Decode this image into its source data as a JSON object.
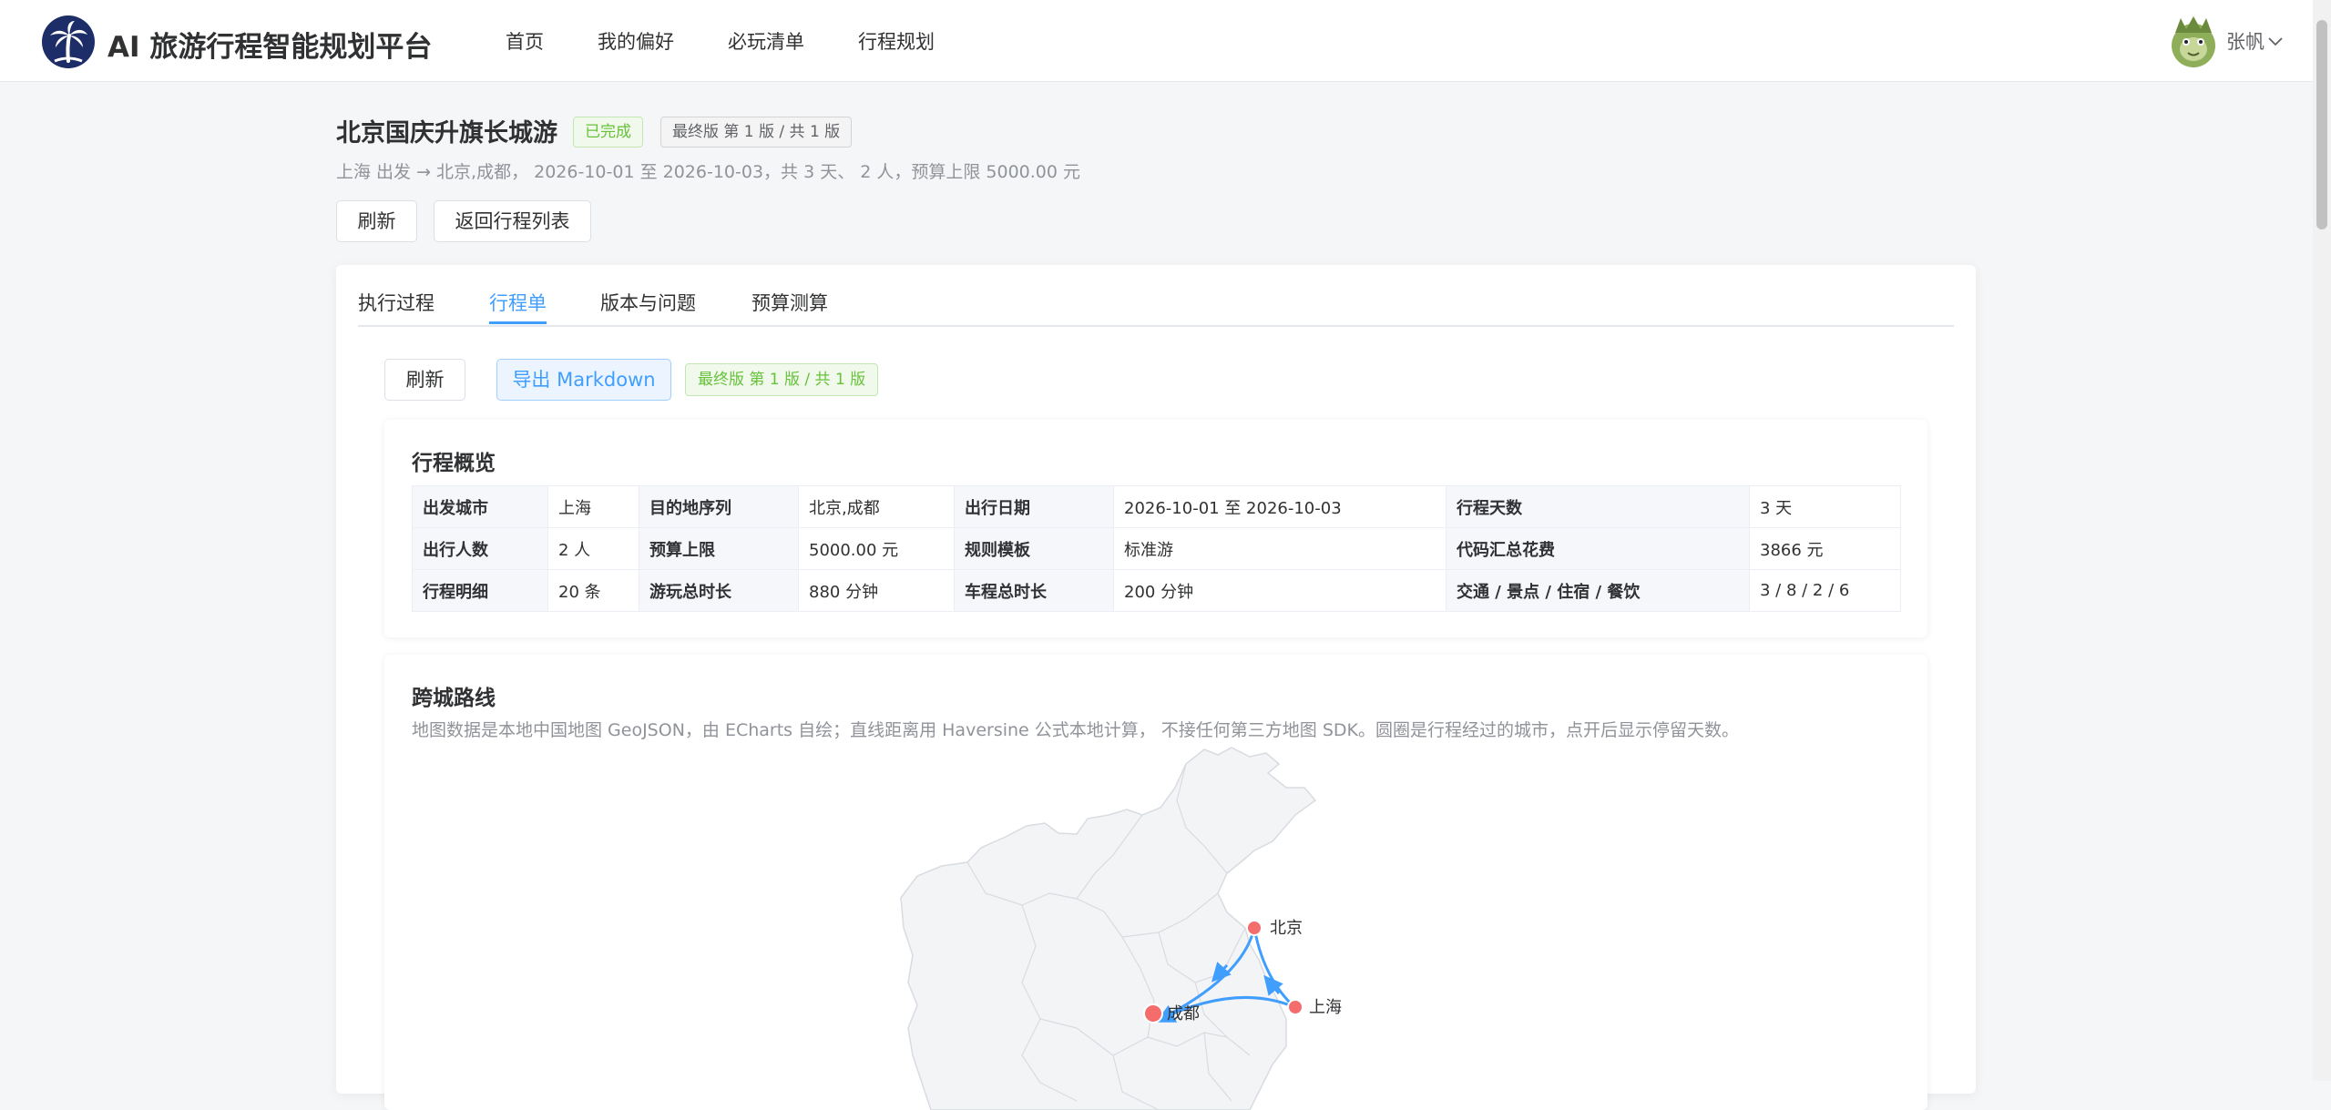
{
  "app": {
    "brand": "AI 旅游行程智能规划平台",
    "nav": [
      "首页",
      "我的偏好",
      "必玩清单",
      "行程规划"
    ],
    "user": {
      "name": "张帆"
    }
  },
  "trip": {
    "title": "北京国庆升旗长城游",
    "status": "已完成",
    "version_tag": "最终版 第 1 版 / 共 1 版",
    "summary": "上海 出发 → 北京,成都， 2026-10-01 至 2026-10-03，共 3 天、 2 人，预算上限 5000.00 元",
    "refresh_label": "刷新",
    "back_label": "返回行程列表"
  },
  "tabs": [
    {
      "label": "执行过程",
      "active": false
    },
    {
      "label": "行程单",
      "active": true
    },
    {
      "label": "版本与问题",
      "active": false
    },
    {
      "label": "预算测算",
      "active": false
    }
  ],
  "itinerary": {
    "refresh_label": "刷新",
    "export_label": "导出 Markdown",
    "version_tag": "最终版 第 1 版 / 共 1 版",
    "overview": {
      "title": "行程概览",
      "rows": [
        [
          {
            "label": "出发城市",
            "value": "上海"
          },
          {
            "label": "目的地序列",
            "value": "北京,成都"
          },
          {
            "label": "出行日期",
            "value": "2026-10-01 至 2026-10-03"
          },
          {
            "label": "行程天数",
            "value": "3 天"
          }
        ],
        [
          {
            "label": "出行人数",
            "value": "2 人"
          },
          {
            "label": "预算上限",
            "value": "5000.00 元"
          },
          {
            "label": "规则模板",
            "value": "标准游"
          },
          {
            "label": "代码汇总花费",
            "value": "3866 元"
          }
        ],
        [
          {
            "label": "行程明细",
            "value": "20 条"
          },
          {
            "label": "游玩总时长",
            "value": "880 分钟"
          },
          {
            "label": "车程总时长",
            "value": "200 分钟"
          },
          {
            "label": "交通 / 景点 / 住宿 / 餐饮",
            "value": "3 / 8 / 2 / 6"
          }
        ]
      ]
    },
    "route": {
      "title": "跨城路线",
      "description": "地图数据是本地中国地图 GeoJSON，由 ECharts 自绘；直线距离用 Haversine 公式本地计算， 不接任何第三方地图 SDK。圆圈是行程经过的城市，点开后显示停留天数。",
      "cities": [
        "北京",
        "上海",
        "成都"
      ],
      "route_color": "#409eff",
      "city_color": "#f56c6c"
    }
  }
}
